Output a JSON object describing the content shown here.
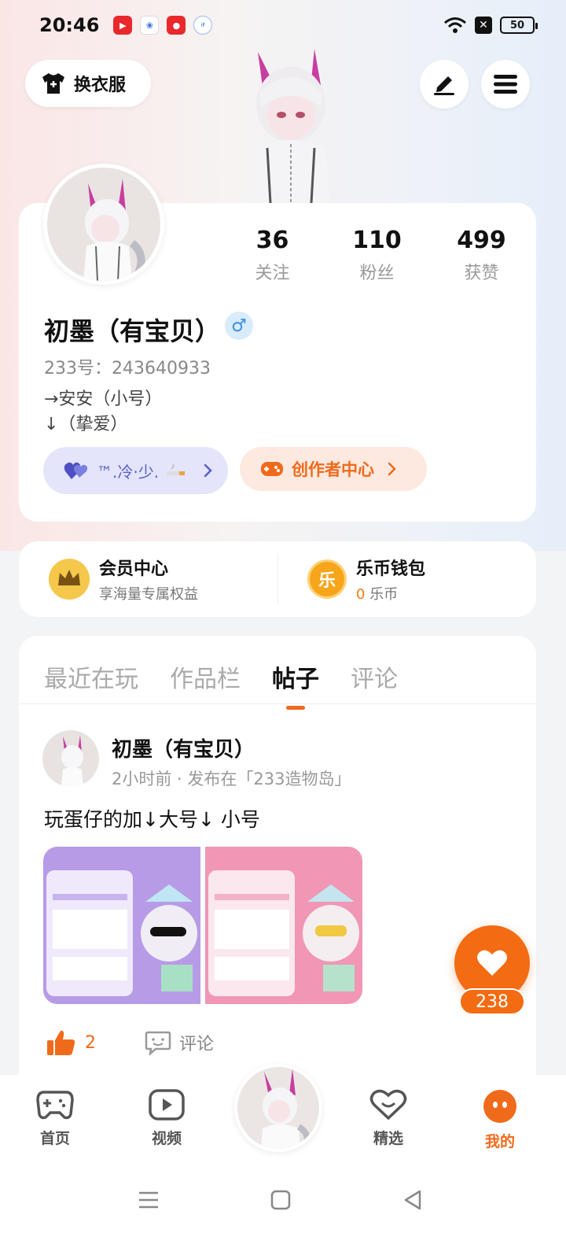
{
  "status_bar": {
    "time": "20:46",
    "battery": "50"
  },
  "header": {
    "outfit_label": "换衣服"
  },
  "profile": {
    "nickname": "初墨（有宝贝）",
    "gender_symbol": "♂",
    "uid": "233号：243640933",
    "bio_line1": "→安安（小号）",
    "bio_line2": "↓（挚爱）",
    "stats": [
      {
        "num": "36",
        "label": "关注"
      },
      {
        "num": "110",
        "label": "粉丝"
      },
      {
        "num": "499",
        "label": "获赞"
      }
    ],
    "family_label": "™.冷·少.",
    "creator_label": "创作者中心"
  },
  "vip": {
    "member_title": "会员中心",
    "member_sub": "享海量专属权益",
    "wallet_title": "乐币钱包",
    "wallet_num": "0",
    "wallet_unit": "乐币",
    "wallet_icon_char": "乐"
  },
  "tabs": [
    "最近在玩",
    "作品栏",
    "帖子",
    "评论"
  ],
  "post": {
    "author": "初墨（有宝贝）",
    "meta": "2小时前 · 发布在「233造物岛」",
    "text": "玩蛋仔的加↓大号↓ 小号",
    "like_count": "2",
    "comment_label": "评论"
  },
  "float_like_count": "238",
  "bottom_nav": [
    {
      "label": "首页"
    },
    {
      "label": "视频"
    },
    {
      "label": "精选"
    },
    {
      "label": "我的"
    }
  ],
  "colors": {
    "accent": "#f06a1b",
    "family_purple": "#5a5fc8",
    "gender_blue": "#3a8ee6"
  }
}
